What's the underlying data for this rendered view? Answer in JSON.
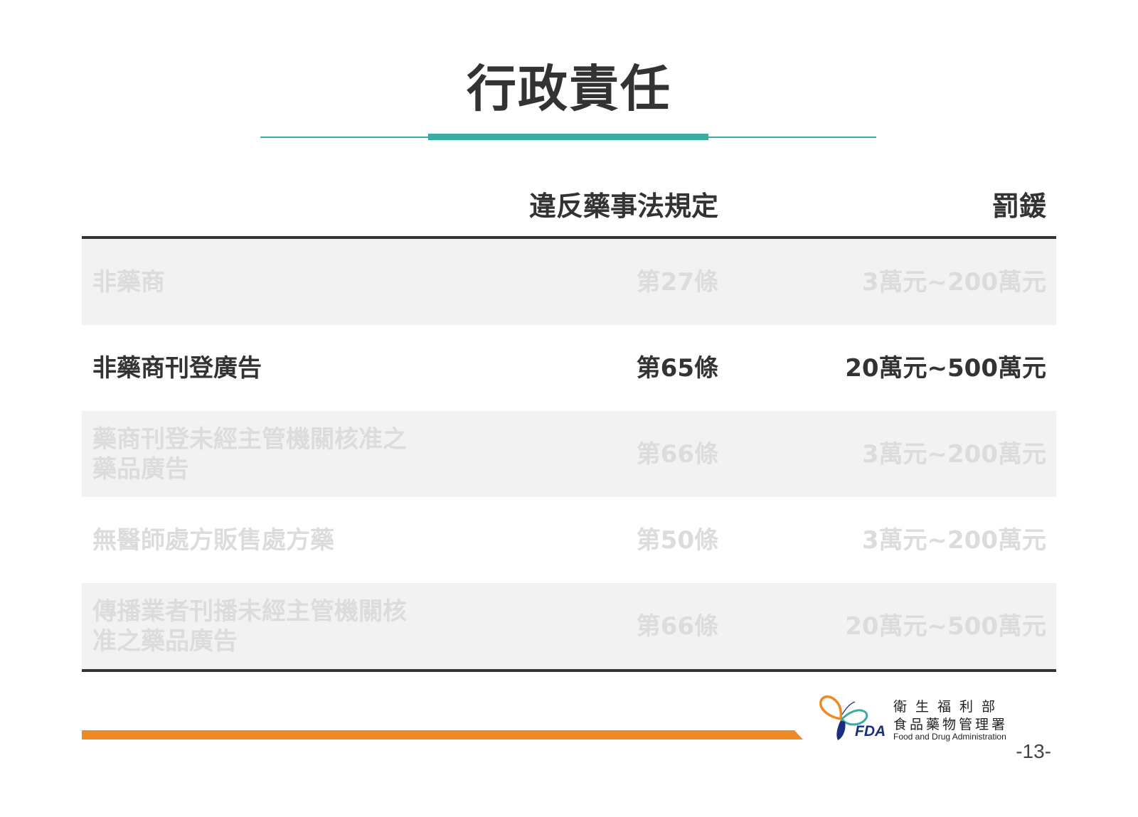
{
  "slide": {
    "title": "行政責任",
    "page_number": "-13-"
  },
  "table": {
    "headers": {
      "subject": "",
      "article": "違反藥事法規定",
      "fine": "罰鍰"
    },
    "rows": [
      {
        "subject": "非藥商",
        "article": "第27條",
        "fine": "3萬元~200萬元",
        "highlighted": false
      },
      {
        "subject": "非藥商刊登廣告",
        "article": "第65條",
        "fine": "20萬元~500萬元",
        "highlighted": true
      },
      {
        "subject": "藥商刊登未經主管機關核准之藥品廣告",
        "article": "第66條",
        "fine": "3萬元~200萬元",
        "highlighted": false
      },
      {
        "subject": "無醫師處方販售處方藥",
        "article": "第50條",
        "fine": "3萬元~200萬元",
        "highlighted": false
      },
      {
        "subject": "傳播業者刊播未經主管機關核准之藥品廣告",
        "article": "第66條",
        "fine": "20萬元~500萬元",
        "highlighted": false
      }
    ]
  },
  "logo": {
    "mark": "FDA",
    "line1": "衛生福利部",
    "line2": "食品藥物管理署",
    "line3": "Food and Drug Administration"
  },
  "colors": {
    "accent_teal": "#3aada0",
    "accent_orange": "#ee8a26",
    "text_dark": "#333333",
    "text_faded": "#dcdcdc",
    "row_shade": "#f2f2f2"
  }
}
